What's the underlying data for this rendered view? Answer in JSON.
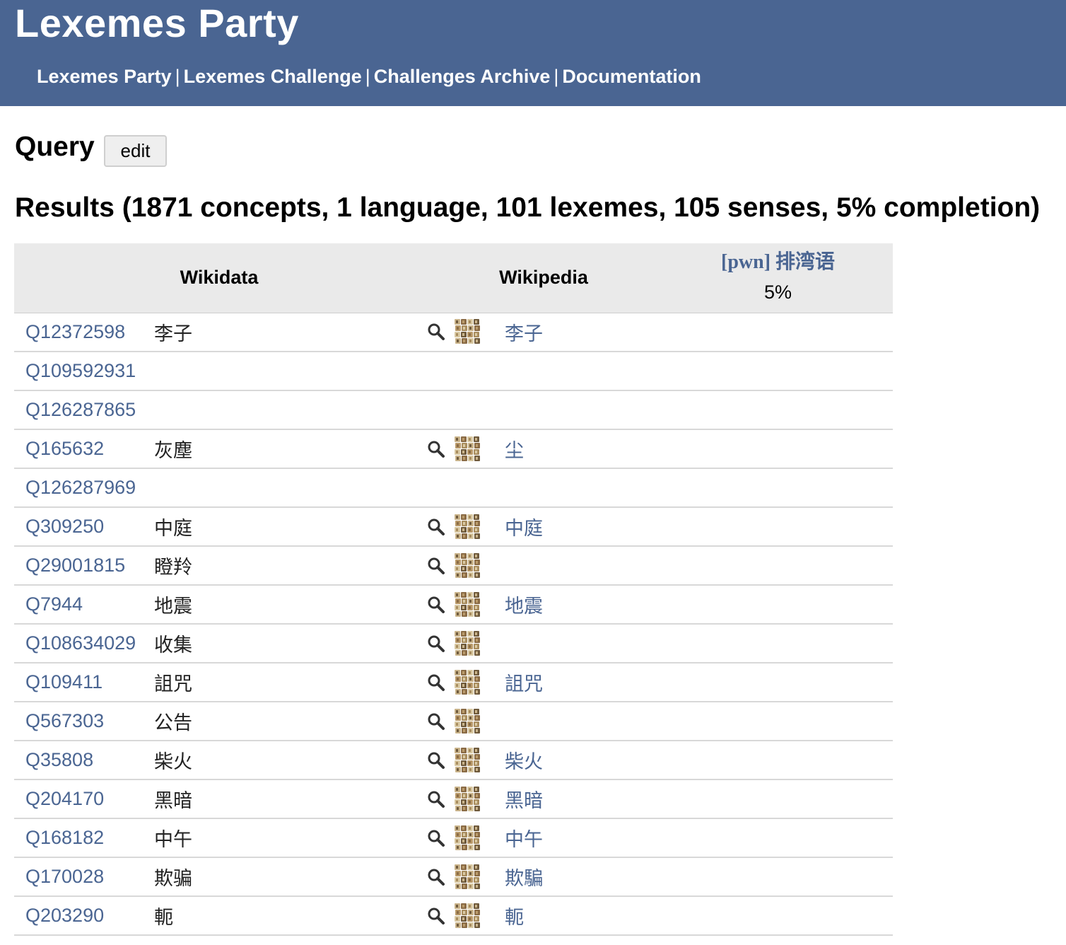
{
  "header": {
    "title": "Lexemes Party",
    "nav": [
      "Lexemes Party",
      "Lexemes Challenge",
      "Challenges Archive",
      "Documentation"
    ],
    "separator": "|"
  },
  "query": {
    "heading": "Query",
    "edit_label": "edit"
  },
  "results": {
    "heading": "Results (1871 concepts, 1 language, 101 lexemes, 105 senses, 5% completion)"
  },
  "table": {
    "columns": {
      "wikidata": "Wikidata",
      "wikipedia": "Wikipedia",
      "language": "[pwn] 排湾语",
      "language_completion": "5%"
    },
    "rows": [
      {
        "qid": "Q12372598",
        "label": "李子",
        "wikipedia": "李子",
        "tools": true
      },
      {
        "qid": "Q109592931",
        "label": "",
        "wikipedia": "",
        "tools": false
      },
      {
        "qid": "Q126287865",
        "label": "",
        "wikipedia": "",
        "tools": false
      },
      {
        "qid": "Q165632",
        "label": "灰塵",
        "wikipedia": "尘",
        "tools": true
      },
      {
        "qid": "Q126287969",
        "label": "",
        "wikipedia": "",
        "tools": false
      },
      {
        "qid": "Q309250",
        "label": "中庭",
        "wikipedia": "中庭",
        "tools": true
      },
      {
        "qid": "Q29001815",
        "label": "瞪羚",
        "wikipedia": "",
        "tools": true
      },
      {
        "qid": "Q7944",
        "label": "地震",
        "wikipedia": "地震",
        "tools": true
      },
      {
        "qid": "Q108634029",
        "label": "收集",
        "wikipedia": "",
        "tools": true
      },
      {
        "qid": "Q109411",
        "label": "詛咒",
        "wikipedia": "詛咒",
        "tools": true
      },
      {
        "qid": "Q567303",
        "label": "公告",
        "wikipedia": "",
        "tools": true
      },
      {
        "qid": "Q35808",
        "label": "柴火",
        "wikipedia": "柴火",
        "tools": true
      },
      {
        "qid": "Q204170",
        "label": "黑暗",
        "wikipedia": "黑暗",
        "tools": true
      },
      {
        "qid": "Q168182",
        "label": "中午",
        "wikipedia": "中午",
        "tools": true
      },
      {
        "qid": "Q170028",
        "label": "欺骗",
        "wikipedia": "欺騙",
        "tools": true
      },
      {
        "qid": "Q203290",
        "label": "軛",
        "wikipedia": "軛",
        "tools": true
      }
    ]
  },
  "icons": {
    "search": "magnifier-icon",
    "ordia": "ordia-tiles-icon"
  },
  "colors": {
    "header_bg": "#4a6592",
    "link": "#4a6592",
    "table_header_bg": "#eaeaea"
  }
}
